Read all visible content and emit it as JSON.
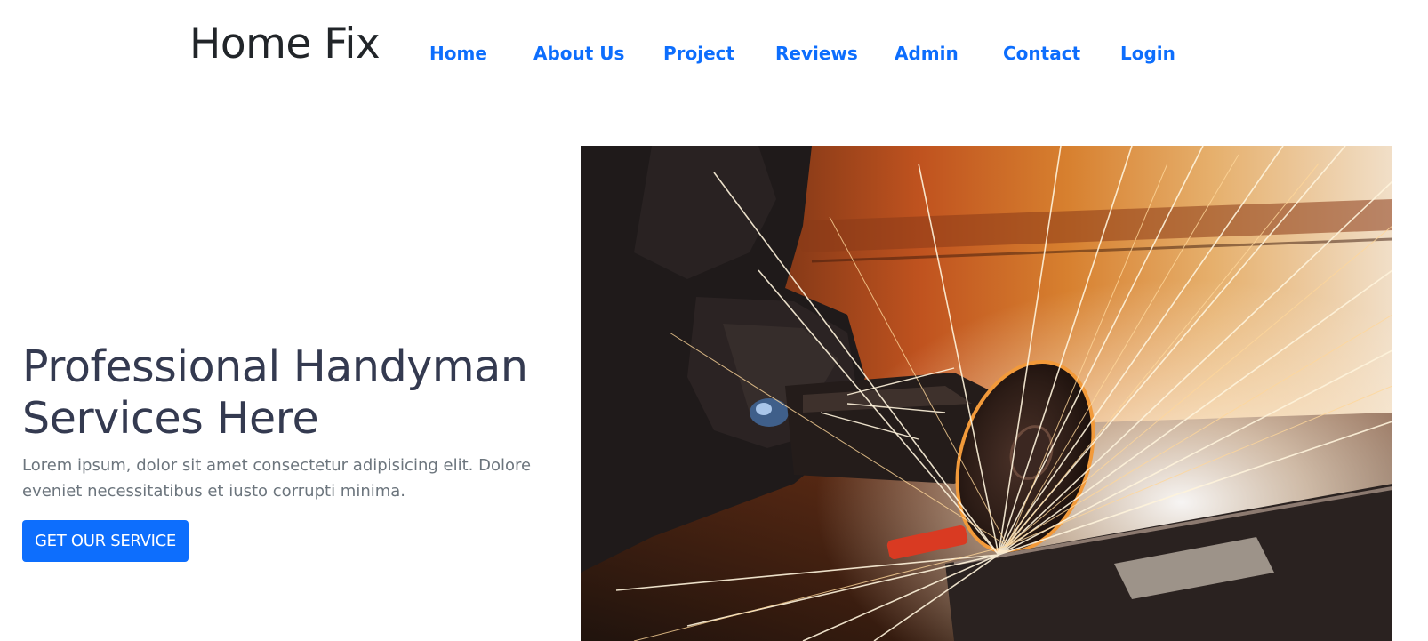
{
  "header": {
    "brand": "Home Fix",
    "nav": [
      {
        "label": "Home"
      },
      {
        "label": "About Us"
      },
      {
        "label": "Project"
      },
      {
        "label": "Reviews"
      },
      {
        "label": "Admin"
      },
      {
        "label": "Contact"
      },
      {
        "label": "Login"
      }
    ]
  },
  "hero": {
    "title": "Professional Handyman Services Here",
    "description": "Lorem ipsum, dolor sit amet consectetur adipisicing elit. Dolore eveniet necessitatibus et iusto corrupti minima.",
    "cta_label": "GET OUR SERVICE",
    "image_icon": "angle-grinder-sparks-photo"
  },
  "colors": {
    "accent": "#0d6efd",
    "heading": "#343a50",
    "muted": "#6c757d",
    "brand_text": "#212529"
  }
}
